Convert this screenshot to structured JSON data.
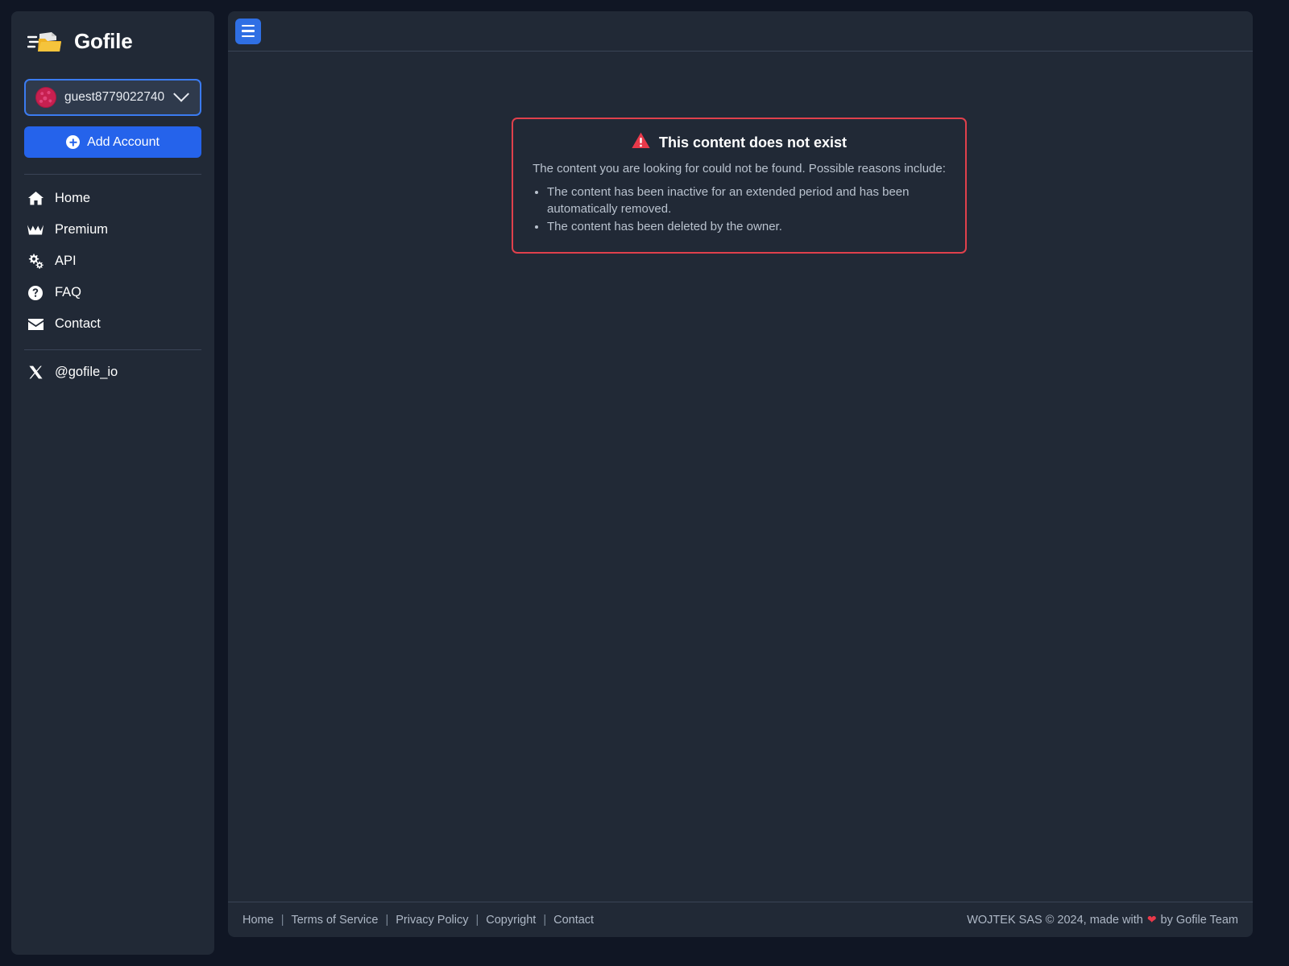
{
  "brand": {
    "name": "Gofile",
    "logo_icon": "gofile-folder-logo"
  },
  "sidebar": {
    "account": {
      "name": "guest8779022740",
      "avatar_icon": "user-avatar-identicon",
      "chevron_icon": "chevron-down-icon"
    },
    "add_account_label": "Add Account",
    "add_account_icon": "plus-circle-icon",
    "items": [
      {
        "label": "Home",
        "icon": "home-icon"
      },
      {
        "label": "Premium",
        "icon": "crown-icon"
      },
      {
        "label": "API",
        "icon": "gears-icon"
      },
      {
        "label": "FAQ",
        "icon": "question-circle-icon"
      },
      {
        "label": "Contact",
        "icon": "envelope-icon"
      }
    ],
    "social": {
      "label": "@gofile_io",
      "icon": "x-twitter-icon"
    }
  },
  "topbar": {
    "menu_icon": "hamburger-menu-icon"
  },
  "error": {
    "icon": "warning-triangle-icon",
    "title": "This content does not exist",
    "subtitle": "The content you are looking for could not be found. Possible reasons include:",
    "reasons": [
      "The content has been inactive for an extended period and has been automatically removed.",
      "The content has been deleted by the owner."
    ]
  },
  "footer": {
    "links": [
      "Home",
      "Terms of Service",
      "Privacy Policy",
      "Copyright",
      "Contact"
    ],
    "separator": "|",
    "copyright_before": "WOJTEK SAS © 2024, made with",
    "heart_icon": "heart-icon",
    "heart_glyph": "❤",
    "copyright_after": "by Gofile Team"
  },
  "colors": {
    "accent_blue": "#2563eb",
    "panel": "#212936",
    "page_bg": "#101624",
    "error_red": "#e0404c",
    "heart_red": "#e8394a"
  }
}
